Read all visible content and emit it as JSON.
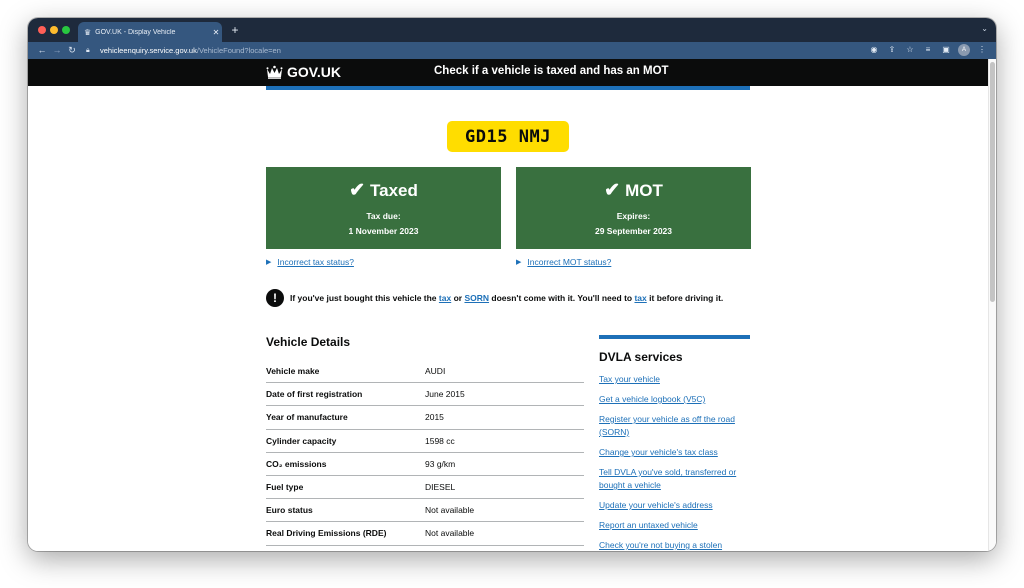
{
  "browser": {
    "tab_title": "GOV.UK - Display Vehicle",
    "url_host": "vehicleenquiry.service.gov.uk",
    "url_path": "/VehicleFound?locale=en",
    "avatar_initial": "A"
  },
  "header": {
    "logo_text": "GOV.UK",
    "service_name": "Check if a vehicle is taxed and has an MOT"
  },
  "registration": "GD15 NMJ",
  "tax_panel": {
    "status": "Taxed",
    "label": "Tax due:",
    "date": "1 November 2023",
    "details_link": "Incorrect tax status?"
  },
  "mot_panel": {
    "status": "MOT",
    "label": "Expires:",
    "date": "29 September 2023",
    "details_link": "Incorrect MOT status?"
  },
  "warning": {
    "text_1": "If you've just bought this vehicle the",
    "link_tax": "tax",
    "text_2": "or",
    "link_sorn": "SORN",
    "text_3": "doesn't come with it. You'll need to",
    "link_tax_2": "tax",
    "text_4": "it before driving it."
  },
  "vehicle_details": {
    "title": "Vehicle Details",
    "rows": [
      {
        "key": "Vehicle make",
        "value": "AUDI"
      },
      {
        "key": "Date of first registration",
        "value": "June 2015"
      },
      {
        "key": "Year of manufacture",
        "value": "2015"
      },
      {
        "key": "Cylinder capacity",
        "value": "1598 cc"
      },
      {
        "key": "CO₂ emissions",
        "value": "93 g/km"
      },
      {
        "key": "Fuel type",
        "value": "DIESEL"
      },
      {
        "key": "Euro status",
        "value": "Not available"
      },
      {
        "key": "Real Driving Emissions (RDE)",
        "value": "Not available"
      }
    ]
  },
  "dvla_services": {
    "title": "DVLA services",
    "links": [
      "Tax your vehicle",
      "Get a vehicle logbook (V5C)",
      "Register your vehicle as off the road (SORN)",
      "Change your vehicle's tax class",
      "Tell DVLA you've sold, transferred or bought a vehicle",
      "Update your vehicle's address",
      "Report an untaxed vehicle",
      "Check you're not buying a stolen"
    ]
  },
  "colors": {
    "gov_black": "#0b0c0c",
    "gov_blue": "#1d70b8",
    "panel_green": "#39703f",
    "plate_yellow": "#ffdd00"
  }
}
